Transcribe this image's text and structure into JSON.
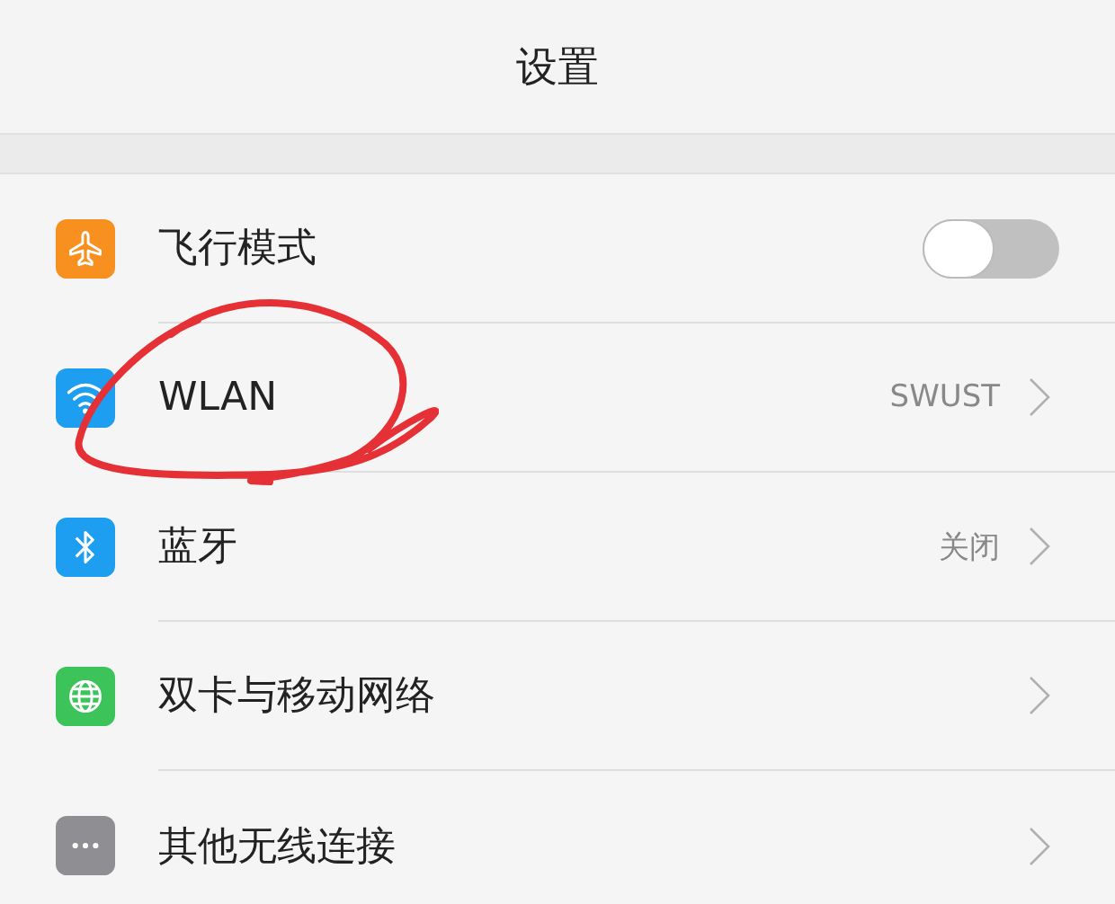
{
  "title": "设置",
  "items": [
    {
      "kind": "switch",
      "label": "飞行模式",
      "color": "#f7901e",
      "on": false
    },
    {
      "kind": "link",
      "label": "WLAN",
      "color": "#1e9ef0",
      "value": "SWUST"
    },
    {
      "kind": "link",
      "label": "蓝牙",
      "color": "#1e9ef0",
      "value": "关闭"
    },
    {
      "kind": "link",
      "label": "双卡与移动网络",
      "color": "#3cc35a"
    },
    {
      "kind": "link",
      "label": "其他无线连接",
      "color": "#8e8e93"
    }
  ]
}
